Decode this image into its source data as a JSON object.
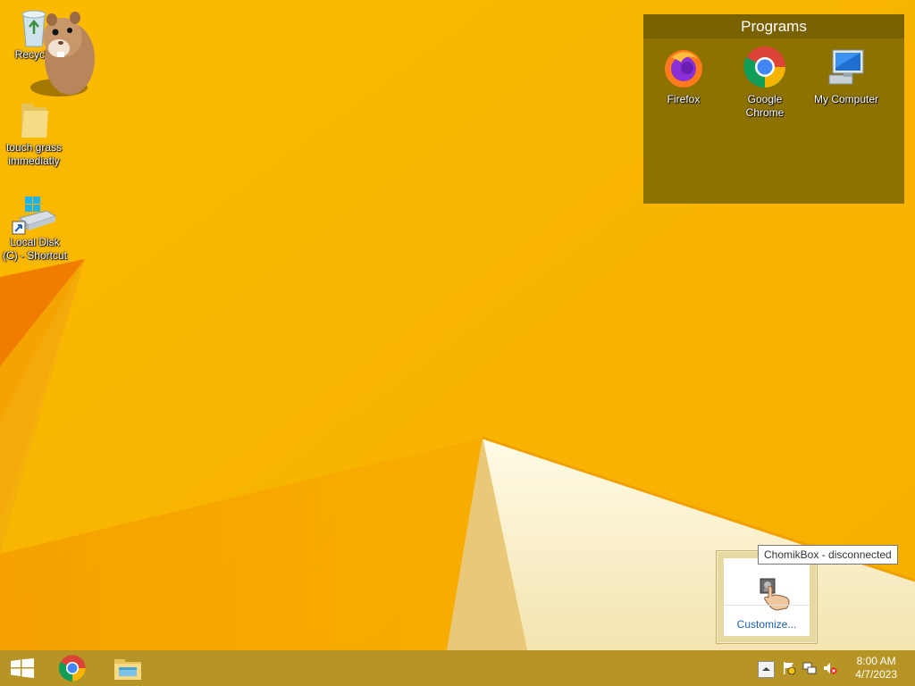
{
  "desktop": {
    "icons": [
      {
        "id": "recycle",
        "label": "Recycle"
      },
      {
        "id": "folder",
        "label": "touch grass immediatly"
      },
      {
        "id": "disk",
        "label": "Local Disk (C) - Shortcut"
      }
    ]
  },
  "programs_panel": {
    "title": "Programs",
    "items": [
      {
        "label": "Firefox",
        "icon": "firefox-icon"
      },
      {
        "label": "Google Chrome",
        "icon": "chrome-icon"
      },
      {
        "label": "My Computer",
        "icon": "computer-icon"
      }
    ]
  },
  "tray_popup": {
    "customize_label": "Customize...",
    "tooltip": "ChomikBox - disconnected"
  },
  "taskbar": {
    "pinned": [
      "start-button",
      "chrome-icon",
      "file-explorer-icon"
    ],
    "clock": {
      "time": "8:00 AM",
      "date": "4/7/2023"
    }
  },
  "colors": {
    "wallpaper_yellow": "#f7b500",
    "wallpaper_orange": "#f08a00",
    "panel": "#8e7200",
    "taskbar": "#b09128"
  }
}
